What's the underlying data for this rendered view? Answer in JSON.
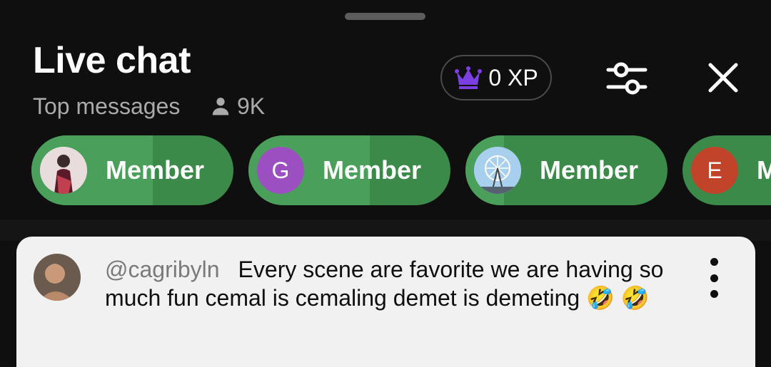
{
  "header": {
    "title": "Live chat",
    "subtitle": "Top messages",
    "viewer_count": "9K",
    "xp_label": "0 XP"
  },
  "member_chips": [
    {
      "avatar_type": "photo",
      "avatar_letter": "",
      "label": "Member",
      "avatar_color": "#d4a5a5"
    },
    {
      "avatar_type": "letter",
      "avatar_letter": "G",
      "label": "Member",
      "avatar_color": "#9c4fc0"
    },
    {
      "avatar_type": "photo",
      "avatar_letter": "",
      "label": "Member",
      "avatar_color": "#9ec9e8"
    },
    {
      "avatar_type": "letter",
      "avatar_letter": "E",
      "label": "M",
      "avatar_color": "#c0432a"
    }
  ],
  "pinned_message": {
    "author": "@cagribyln",
    "text": "Every scene are favorite we are having so much fun cemal is cemaling demet is demeting 🤣 🤣"
  },
  "icons": {
    "crown": "crown-icon",
    "filter": "filter-sliders-icon",
    "close": "close-icon",
    "person": "person-icon",
    "more": "more-vertical-icon"
  },
  "colors": {
    "background": "#0f0f0f",
    "chip_green": "#3c8a4a",
    "chip_green_light": "#4aa05a",
    "crown_purple": "#7b3fe4",
    "card_bg": "#f1f1f1"
  }
}
